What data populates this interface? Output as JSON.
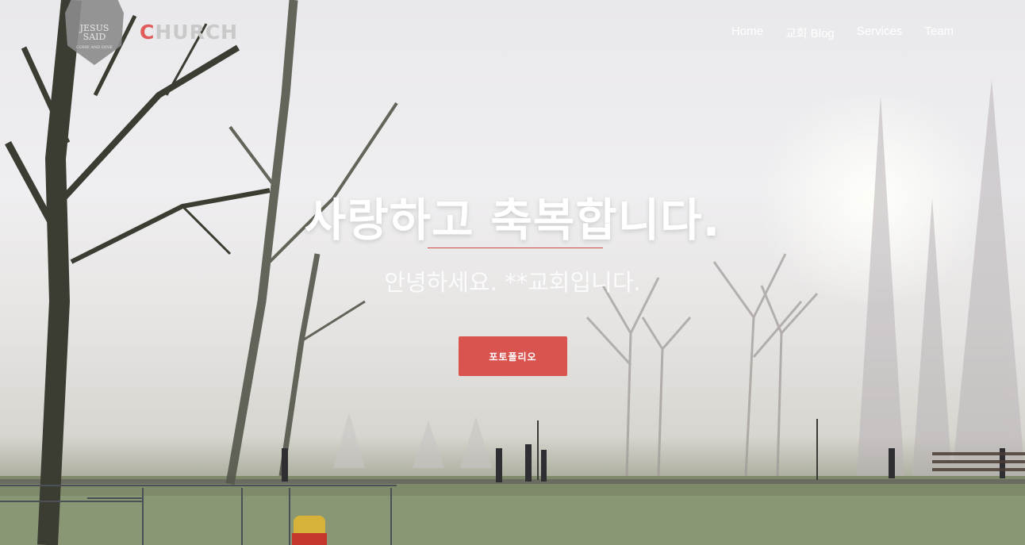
{
  "header": {
    "logo_badge_line1": "JESUS",
    "logo_badge_line2": "SAID",
    "logo_badge_small": "COME AND DINE",
    "brand_first_letter": "C",
    "brand_rest": "HURCH",
    "nav": [
      {
        "label": "Home"
      },
      {
        "label": "교회 Blog"
      },
      {
        "label": "Services"
      },
      {
        "label": "Team"
      }
    ]
  },
  "hero": {
    "headline": "사랑하고 축복합니다.",
    "subline": "안녕하세요. **교회입니다.",
    "cta_label": "포토폴리오"
  },
  "colors": {
    "accent": "#d9534f",
    "brand_accent": "#e15b5b"
  }
}
